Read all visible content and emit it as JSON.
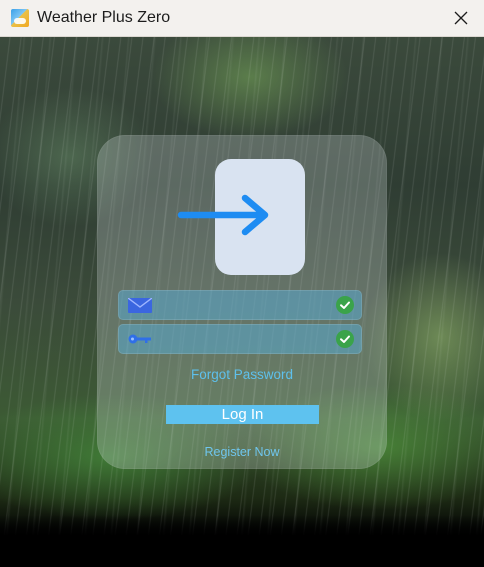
{
  "window": {
    "title": "Weather Plus Zero",
    "app_icon": "weather-app-icon",
    "close_icon": "close-icon"
  },
  "login": {
    "tile_icon": "login-arrow-icon",
    "username": {
      "value": "",
      "placeholder": "",
      "icon": "email-icon",
      "status_icon": "check-circle-icon"
    },
    "password": {
      "value": "",
      "placeholder": "",
      "icon": "key-icon",
      "status_icon": "check-circle-icon"
    },
    "forgot_password": "Forgot Password",
    "login_button": "Log In",
    "register": "Register Now"
  },
  "colors": {
    "accent": "#5ec2ef",
    "arrow": "#1e8cf2",
    "check": "#3aa34a",
    "tile": "#d9e3f1"
  }
}
